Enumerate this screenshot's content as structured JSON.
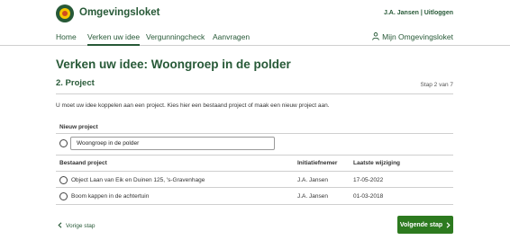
{
  "header": {
    "brand": "Omgevingsloket",
    "user": "J.A. Jansen | Uitloggen"
  },
  "nav": {
    "items": [
      {
        "label": "Home"
      },
      {
        "label": "Verken uw idee"
      },
      {
        "label": "Vergunningcheck"
      },
      {
        "label": "Aanvragen"
      }
    ],
    "account": "Mijn Omgevingsloket"
  },
  "page": {
    "title": "Verken uw idee: Woongroep in de polder",
    "section": "2. Project",
    "step": "Stap 2 van 7",
    "description": "U moet uw idee koppelen aan een project. Kies hier een bestaand project of maak een nieuw project aan."
  },
  "new_project": {
    "label": "Nieuw project",
    "value": "Woongroep in de polder"
  },
  "existing": {
    "headers": [
      "Bestaand project",
      "Initiatiefnemer",
      "Laatste wijziging"
    ],
    "rows": [
      {
        "name": "Object Laan van Eik en Duinen 125, 's-Gravenhage",
        "owner": "J.A. Jansen",
        "date": "17-05-2022"
      },
      {
        "name": "Boom kappen in de achtertuin",
        "owner": "J.A. Jansen",
        "date": "01-03-2018"
      }
    ]
  },
  "footer": {
    "prev": "Vorige stap",
    "next": "Volgende stap"
  },
  "colors": {
    "brand_green": "#275937",
    "button_green": "#2d7a1f"
  },
  "icons": [
    "logo-icon",
    "person-icon",
    "chevron-left-icon",
    "chevron-right-icon"
  ]
}
